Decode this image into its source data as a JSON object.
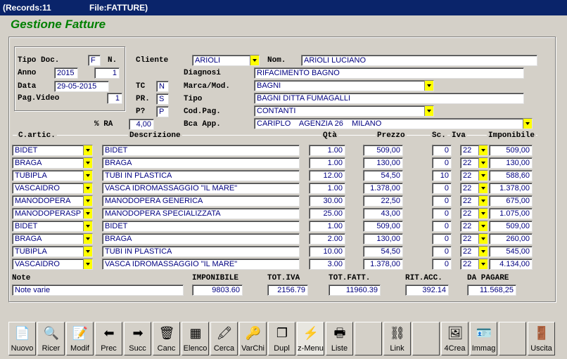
{
  "titlebar": {
    "records": "(Records:11",
    "file": "File:FATTURE)"
  },
  "app_title": "Gestione Fatture",
  "header": {
    "tipo_doc_label": "Tipo Doc.",
    "tipo_doc_value": "F",
    "n_label": "N.",
    "n_value": "",
    "anno_label": "Anno",
    "anno_value": "2015",
    "anno_n_value": "1",
    "data_label": "Data",
    "data_value": "29-05-2015",
    "pag_video_label": "Pag.Video",
    "pag_video_value": "1",
    "cliente_label": "Cliente",
    "cliente_value": "ARIOLI",
    "nom_label": "Nom.",
    "nom_value": "ARIOLI LUCIANO",
    "diagnosi_label": "Diagnosi",
    "diagnosi_value": "RIFACIMENTO BAGNO",
    "tc_label": "TC",
    "tc_value": "N",
    "marca_label": "Marca/Mod.",
    "marca_value": "BAGNI",
    "pr_label": "PR.",
    "pr_value": "S",
    "tipo_label": "Tipo",
    "tipo_value": "BAGNI DITTA FUMAGALLI",
    "pq_label": "P?",
    "pq_value": "P",
    "codpag_label": "Cod.Pag.",
    "codpag_value": "CONTANTI",
    "ra_label": "% RA",
    "ra_value": "4,00",
    "bca_label": "Bca App.",
    "bca_value": "CARIPLO    AGENZIA 26    MILANO"
  },
  "columns": {
    "c_artic": "C.artic.",
    "descrizione": "Descrizione",
    "qta": "Qtà",
    "prezzo": "Prezzo",
    "sc": "Sc.",
    "iva": "Iva",
    "imponibile": "Imponibile"
  },
  "rows": [
    {
      "code": "BIDET",
      "desc": "BIDET",
      "qta": "1.00",
      "prezzo": "509,00",
      "sc": "0",
      "iva": "22",
      "imp": "509,00"
    },
    {
      "code": "BRAGA",
      "desc": "BRAGA",
      "qta": "1.00",
      "prezzo": "130,00",
      "sc": "0",
      "iva": "22",
      "imp": "130,00"
    },
    {
      "code": "TUBIPLA",
      "desc": "TUBI IN PLASTICA",
      "qta": "12.00",
      "prezzo": "54,50",
      "sc": "10",
      "iva": "22",
      "imp": "588,60"
    },
    {
      "code": "VASCAIDRO",
      "desc": "VASCA IDROMASSAGGIO \"IL MARE\"",
      "qta": "1.00",
      "prezzo": "1.378,00",
      "sc": "0",
      "iva": "22",
      "imp": "1.378,00"
    },
    {
      "code": "MANODOPERA",
      "desc": "MANODOPERA GENERICA",
      "qta": "30.00",
      "prezzo": "22,50",
      "sc": "0",
      "iva": "22",
      "imp": "675,00"
    },
    {
      "code": "MANODOPERASP",
      "desc": "MANODOPERA SPECIALIZZATA",
      "qta": "25.00",
      "prezzo": "43,00",
      "sc": "0",
      "iva": "22",
      "imp": "1.075,00"
    },
    {
      "code": "BIDET",
      "desc": "BIDET",
      "qta": "1.00",
      "prezzo": "509,00",
      "sc": "0",
      "iva": "22",
      "imp": "509,00"
    },
    {
      "code": "BRAGA",
      "desc": "BRAGA",
      "qta": "2.00",
      "prezzo": "130,00",
      "sc": "0",
      "iva": "22",
      "imp": "260,00"
    },
    {
      "code": "TUBIPLA",
      "desc": "TUBI IN PLASTICA",
      "qta": "10.00",
      "prezzo": "54,50",
      "sc": "0",
      "iva": "22",
      "imp": "545,00"
    },
    {
      "code": "VASCAIDRO",
      "desc": "VASCA IDROMASSAGGIO \"IL MARE\"",
      "qta": "3.00",
      "prezzo": "1.378,00",
      "sc": "0",
      "iva": "22",
      "imp": "4.134,00"
    }
  ],
  "totals": {
    "note_label": "Note",
    "note_value": "Note varie",
    "imponibile_label": "IMPONIBILE",
    "imponibile_value": "9803.60",
    "totiva_label": "TOT.IVA",
    "totiva_value": "2156.79",
    "totfatt_label": "TOT.FATT.",
    "totfatt_value": "11960.39",
    "ritacc_label": "RIT.ACC.",
    "ritacc_value": "392.14",
    "dapagare_label": "DA PAGARE",
    "dapagare_value": "11.568,25"
  },
  "toolbar": [
    {
      "label": "Nuovo",
      "icon": "new-document-icon",
      "glyph": "📄"
    },
    {
      "label": "Ricer",
      "icon": "search-icon",
      "glyph": "🔍"
    },
    {
      "label": "Modif",
      "icon": "edit-icon",
      "glyph": "📝"
    },
    {
      "label": "Prec",
      "icon": "arrow-left-icon",
      "glyph": "⬅"
    },
    {
      "label": "Succ",
      "icon": "arrow-right-icon",
      "glyph": "➡"
    },
    {
      "label": "Canc",
      "icon": "trash-icon",
      "glyph": "🗑"
    },
    {
      "label": "Elenco",
      "icon": "list-icon",
      "glyph": "▦"
    },
    {
      "label": "Cerca",
      "icon": "find-icon",
      "glyph": "🖍"
    },
    {
      "label": "VarChi",
      "icon": "keys-icon",
      "glyph": "🔑"
    },
    {
      "label": "Dupl",
      "icon": "duplicate-icon",
      "glyph": "❐"
    },
    {
      "label": "z-Menu",
      "icon": "menu-icon",
      "glyph": "⚡"
    },
    {
      "label": "Liste",
      "icon": "printer-icon",
      "glyph": "🖶"
    },
    {
      "label": "",
      "icon": "blank-icon",
      "glyph": ""
    },
    {
      "label": "Link",
      "icon": "link-icon",
      "glyph": "⛓"
    },
    {
      "label": "",
      "icon": "blank-icon",
      "glyph": ""
    },
    {
      "label": "4Crea",
      "icon": "create-icon",
      "glyph": "🖼"
    },
    {
      "label": "Immag",
      "icon": "image-icon",
      "glyph": "🪪"
    },
    {
      "label": "",
      "icon": "blank-icon",
      "glyph": ""
    },
    {
      "label": "Uscita",
      "icon": "exit-door-icon",
      "glyph": "🚪"
    }
  ],
  "colors": {
    "title_bar": "#0a246a",
    "app_title": "#008000",
    "field_text": "#000080",
    "combo_button": "#ffff00"
  }
}
